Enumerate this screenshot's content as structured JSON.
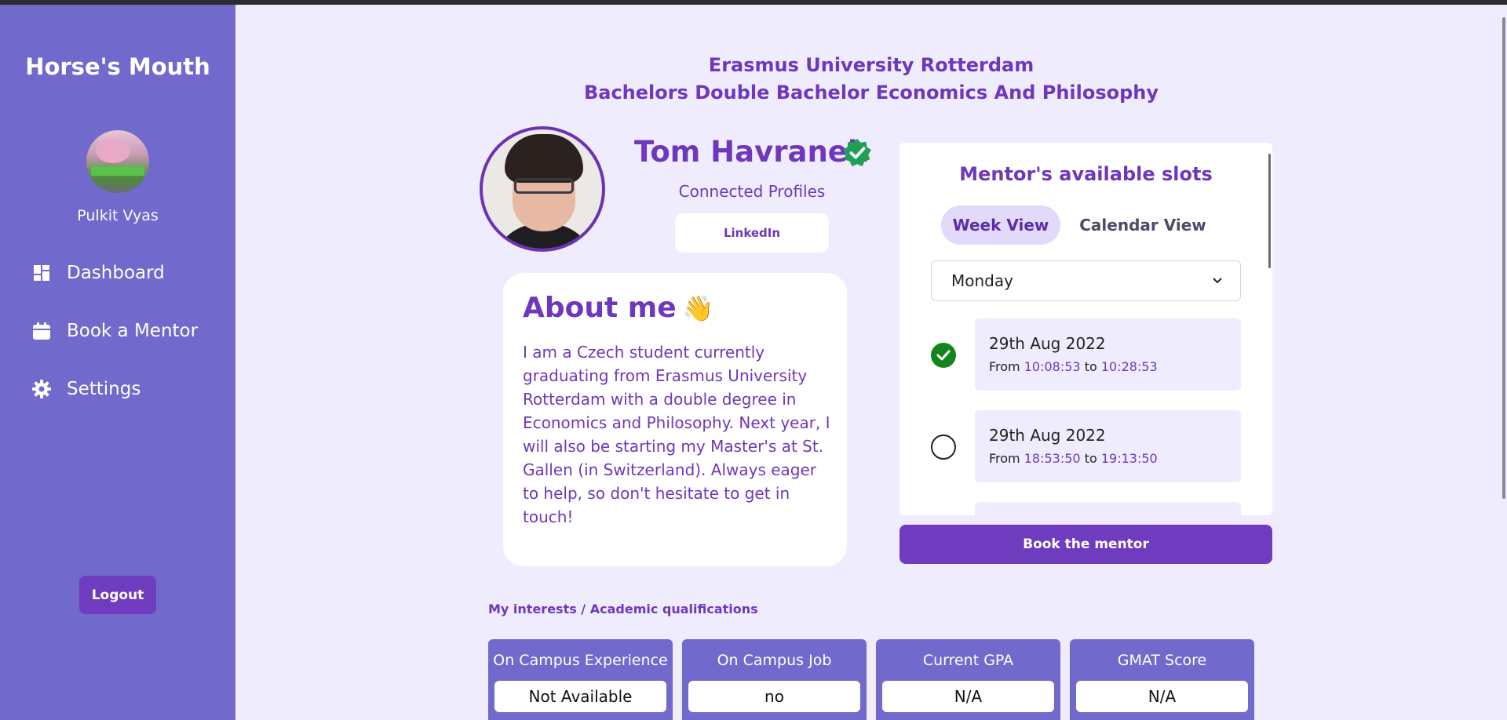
{
  "app": {
    "brand": "Horse's Mouth"
  },
  "user": {
    "name": "Pulkit Vyas"
  },
  "nav": {
    "items": [
      {
        "label": "Dashboard",
        "icon": "dashboard-icon"
      },
      {
        "label": "Book a Mentor",
        "icon": "calendar-icon"
      },
      {
        "label": "Settings",
        "icon": "gear-icon"
      }
    ],
    "logout_label": "Logout"
  },
  "header": {
    "university": "Erasmus University Rotterdam",
    "program": "Bachelors Double Bachelor Economics And Philosophy"
  },
  "mentor": {
    "name": "Tom Havranek",
    "verified_icon": "verified-badge-icon",
    "connected_profiles_label": "Connected Profiles",
    "linkedin_label": "LinkedIn",
    "about_title": "About me",
    "about_emoji": "👋",
    "about_text": "I am a Czech student currently graduating from Erasmus University Rotterdam with a double degree in Economics and Philosophy. Next year, I will also be starting my Master's at St. Gallen (in Switzerland). Always eager to help, so don't hesitate to get in touch!"
  },
  "slots": {
    "title": "Mentor's available slots",
    "tabs": [
      {
        "label": "Week View",
        "active": true
      },
      {
        "label": "Calendar View",
        "active": false
      }
    ],
    "selected_day": "Monday",
    "from_word": "From",
    "to_word": "to",
    "items": [
      {
        "date": "29th Aug 2022",
        "from": "10:08:53",
        "to": "10:28:53",
        "selected": true
      },
      {
        "date": "29th Aug 2022",
        "from": "18:53:50",
        "to": "19:13:50",
        "selected": false
      }
    ],
    "book_label": "Book the mentor"
  },
  "qualifications": {
    "title": "My interests / Academic qualifications",
    "items": [
      {
        "label": "On Campus Experience",
        "value": "Not Available"
      },
      {
        "label": "On Campus Job",
        "value": "no"
      },
      {
        "label": "Current GPA",
        "value": "N/A"
      },
      {
        "label": "GMAT Score",
        "value": "N/A"
      }
    ]
  },
  "colors": {
    "sidebar": "#7169cc",
    "accent": "#6e37bc",
    "background": "#efedfd",
    "verified": "#1ea055",
    "selected_slot": "#12851c"
  }
}
